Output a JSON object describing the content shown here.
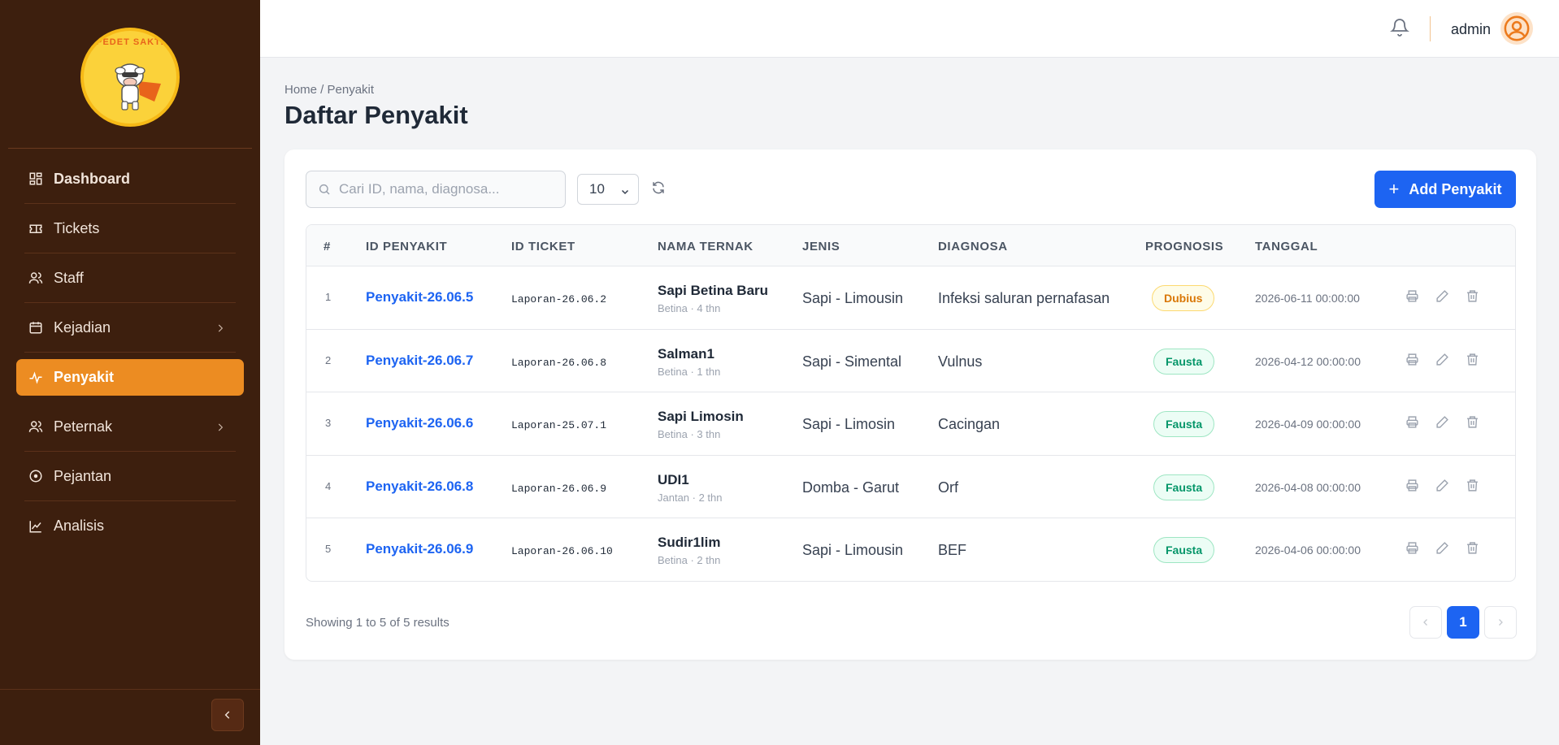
{
  "sidebar": {
    "logo_text": "PEDET SAKTI",
    "items": [
      {
        "label": "Dashboard",
        "icon": "dashboard-icon"
      },
      {
        "label": "Tickets",
        "icon": "ticket-icon"
      },
      {
        "label": "Staff",
        "icon": "users-icon"
      },
      {
        "label": "Kejadian",
        "icon": "calendar-icon",
        "has_submenu": true
      },
      {
        "label": "Penyakit",
        "icon": "activity-icon",
        "active": true
      },
      {
        "label": "Peternak",
        "icon": "users-icon",
        "has_submenu": true
      },
      {
        "label": "Pejantan",
        "icon": "circle-icon"
      },
      {
        "label": "Analisis",
        "icon": "chart-line-icon"
      }
    ],
    "active_color": "#ec8c22",
    "background": "#3d1f0e"
  },
  "header": {
    "user": "admin"
  },
  "breadcrumb": "Home / Penyakit",
  "page_title": "Daftar Penyakit",
  "toolbar": {
    "search_placeholder": "Cari ID, nama, diagnosa...",
    "per_page": "10",
    "add_label": "Add Penyakit"
  },
  "table": {
    "columns": [
      "#",
      "ID PENYAKIT",
      "ID TICKET",
      "NAMA TERNAK",
      "JENIS",
      "DIAGNOSA",
      "PROGNOSIS",
      "TANGGAL"
    ],
    "rows": [
      {
        "num": "1",
        "id": "Penyakit-26.06.5",
        "ticket": "Laporan-26.06.2",
        "name": "Sapi Betina Baru",
        "sub": "Betina · 4 thn",
        "jenis": "Sapi - Limousin",
        "diagnosa": "Infeksi saluran pernafasan",
        "prognosis": "Dubius",
        "tanggal": "2026-06-11 00:00:00"
      },
      {
        "num": "2",
        "id": "Penyakit-26.06.7",
        "ticket": "Laporan-26.06.8",
        "name": "Salman1",
        "sub": "Betina · 1 thn",
        "jenis": "Sapi - Simental",
        "diagnosa": "Vulnus",
        "prognosis": "Fausta",
        "tanggal": "2026-04-12 00:00:00"
      },
      {
        "num": "3",
        "id": "Penyakit-26.06.6",
        "ticket": "Laporan-25.07.1",
        "name": "Sapi Limosin",
        "sub": "Betina · 3 thn",
        "jenis": "Sapi - Limosin",
        "diagnosa": "Cacingan",
        "prognosis": "Fausta",
        "tanggal": "2026-04-09 00:00:00"
      },
      {
        "num": "4",
        "id": "Penyakit-26.06.8",
        "ticket": "Laporan-26.06.9",
        "name": "UDI1",
        "sub": "Jantan · 2 thn",
        "jenis": "Domba - Garut",
        "diagnosa": "Orf",
        "prognosis": "Fausta",
        "tanggal": "2026-04-08 00:00:00"
      },
      {
        "num": "5",
        "id": "Penyakit-26.06.9",
        "ticket": "Laporan-26.06.10",
        "name": "Sudir1lim",
        "sub": "Betina · 2 thn",
        "jenis": "Sapi - Limousin",
        "diagnosa": "BEF",
        "prognosis": "Fausta",
        "tanggal": "2026-04-06 00:00:00"
      }
    ]
  },
  "pagination": {
    "summary": "Showing 1 to 5 of 5 results",
    "current": "1"
  },
  "colors": {
    "primary": "#1d64f2",
    "dubius": "#d97706",
    "fausta": "#059669"
  }
}
